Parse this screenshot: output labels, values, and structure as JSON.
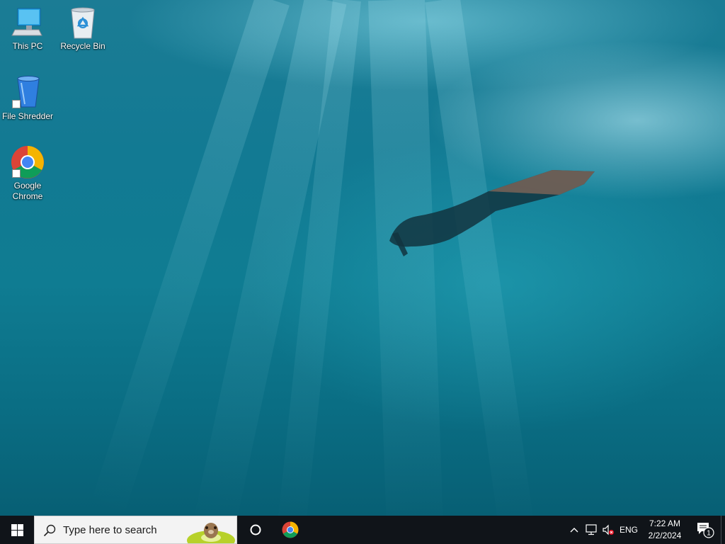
{
  "desktop": {
    "icons": [
      {
        "label": "This PC",
        "icon": "this-pc-icon"
      },
      {
        "label": "Recycle Bin",
        "icon": "recycle-bin-icon"
      },
      {
        "label": "File Shredder",
        "icon": "file-shredder-icon"
      },
      {
        "label": "Google Chrome",
        "icon": "chrome-icon"
      }
    ]
  },
  "taskbar": {
    "search_placeholder": "Type here to search",
    "pinned": [
      {
        "icon": "chrome-icon"
      }
    ],
    "tray": {
      "language": "ENG",
      "time": "7:22 AM",
      "date": "2/2/2024",
      "notification_count": "1"
    }
  },
  "colors": {
    "taskbar": "#101419",
    "water": "#127a93"
  }
}
